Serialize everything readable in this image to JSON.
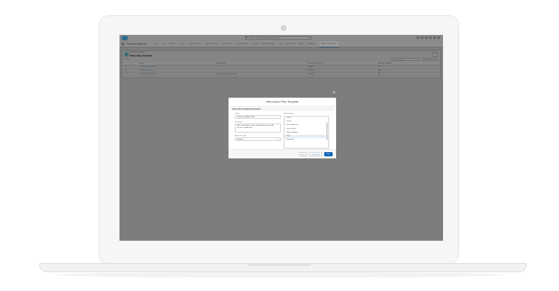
{
  "app": {
    "name": "Financial Services",
    "search_scope": "All",
    "search_placeholder": "Search Action Plan Templates and more...",
    "nav_items": [
      "Home",
      "Pulse",
      "Accounts",
      "Contacts",
      "Financial Accounts",
      "Individual Checklists",
      "Financial Goals",
      "Financial Holdings",
      "Securities",
      "Relationship Maps",
      "Leads",
      "Opportunities",
      "Reports",
      "Dashboards",
      "Action Plan Templates"
    ]
  },
  "list_view": {
    "object_label": "Action Plan Templates",
    "title": "Recently Viewed",
    "new_button": "New",
    "items_count": "3 items •",
    "search_placeholder": "Search this list...",
    "columns": [
      "Name",
      "Template Name",
      "Action Plan Template ID",
      "Action Plan Template"
    ],
    "rows": [
      {
        "num": "1",
        "name": "Open Retail Bank Account",
        "desc": "",
        "type": "Individual",
        "c4": "Yes"
      },
      {
        "num": "2",
        "name": "New Account Review",
        "desc": "",
        "type": "Business",
        "c4": "Never"
      },
      {
        "num": "3",
        "name": "New Client Onboarding",
        "desc": "Client for super client onboarding",
        "type": "Individual",
        "c4": "No"
      }
    ]
  },
  "modal": {
    "title": "New Action Plan Template",
    "close_label": "✕",
    "section": "Action Plan Template Information",
    "name_label": "Name",
    "name_value": "Onboard an MSFW to RM",
    "description_label": "Description",
    "description_value": "Add a client family, review client documents, open RM accounts, handle taxes",
    "target_label": "Action Plan Type",
    "target_value": "Industries",
    "related_label": "Related Target",
    "related_options": [
      "Contact",
      "Contact",
      "Financial Account",
      "Financial Goal",
      "Financial Holding",
      "Lead",
      "Opportunity"
    ],
    "related_selected_index": 5,
    "cancel": "Cancel",
    "save_new": "Save & New",
    "save": "Save"
  },
  "colors": {
    "overlay": "#7d7d7d",
    "brand": "#0d63b3",
    "link": "#0a5ea8"
  }
}
